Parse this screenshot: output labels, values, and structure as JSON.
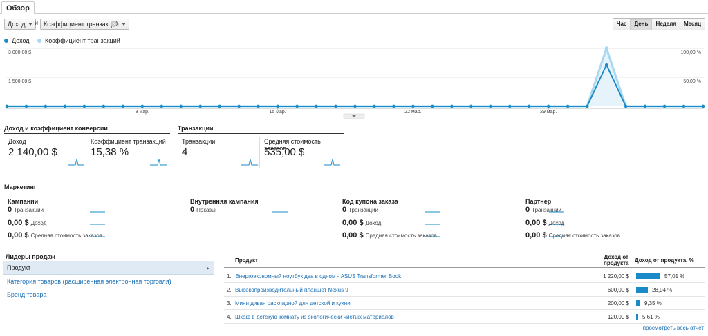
{
  "tabs": [
    {
      "label": "Обзор"
    }
  ],
  "controls": {
    "metric1": "Доход",
    "and_label": "и",
    "metric2": "Коэффициент транзакций",
    "clear": "×",
    "periods": [
      "Час",
      "День",
      "Неделя",
      "Месяц"
    ],
    "active_period": "День"
  },
  "legend": {
    "series1": "Доход",
    "series2": "Коэффициент транзакций",
    "color1": "#1a8bc8",
    "color2": "#a8d8f0"
  },
  "chart_data": {
    "type": "line",
    "x_tick_labels": [
      "8 мар.",
      "15 мар.",
      "22 мар.",
      "29 мар."
    ],
    "x_tick_index": [
      7,
      14,
      21,
      28
    ],
    "y_left_ticks": [
      "3 000,00 $",
      "1 500,00 $"
    ],
    "y_right_ticks": [
      "100,00 %",
      "50,00 %"
    ],
    "y_left_max": 3000,
    "y_right_max": 100,
    "series": [
      {
        "name": "Доход",
        "axis": "left",
        "values": [
          0,
          0,
          0,
          0,
          0,
          0,
          0,
          0,
          0,
          0,
          0,
          0,
          0,
          0,
          0,
          0,
          0,
          0,
          0,
          0,
          0,
          0,
          0,
          0,
          0,
          0,
          0,
          0,
          0,
          0,
          0,
          2140,
          0,
          0,
          0,
          0,
          0
        ]
      },
      {
        "name": "Коэффициент транзакций",
        "axis": "right",
        "values": [
          0,
          0,
          0,
          0,
          0,
          0,
          0,
          0,
          0,
          0,
          0,
          0,
          0,
          0,
          0,
          0,
          0,
          0,
          0,
          0,
          0,
          0,
          0,
          0,
          0,
          0,
          0,
          0,
          0,
          0,
          0,
          100,
          0,
          0,
          0,
          0,
          0
        ]
      }
    ]
  },
  "summary": {
    "section1_title": "Доход и коэффициент конверсии",
    "section2_title": "Транзакции",
    "cards": [
      {
        "label": "Доход",
        "value": "2 140,00 $"
      },
      {
        "label": "Коэффициент транзакций",
        "value": "15,38 %"
      },
      {
        "label": "Транзакции",
        "value": "4"
      },
      {
        "label": "Средняя стоимость заказов",
        "value": "535,00 $"
      }
    ]
  },
  "marketing": {
    "title": "Маркетинг",
    "columns": [
      {
        "heading": "Кампании",
        "rows": [
          {
            "value": "0",
            "label": "Транзакции"
          },
          {
            "value": "0,00 $",
            "label": "Доход"
          },
          {
            "value": "0,00 $",
            "label": "Средняя стоимость заказов"
          }
        ]
      },
      {
        "heading": "Внутренняя кампания",
        "rows": [
          {
            "value": "0",
            "label": "Показы"
          }
        ]
      },
      {
        "heading": "Код купона заказа",
        "rows": [
          {
            "value": "0",
            "label": "Транзакции"
          },
          {
            "value": "0,00 $",
            "label": "Доход"
          },
          {
            "value": "0,00 $",
            "label": "Средняя стоимость заказов"
          }
        ]
      },
      {
        "heading": "Партнер",
        "rows": [
          {
            "value": "0",
            "label": "Транзакции"
          },
          {
            "value": "0,00 $",
            "label": "Доход"
          },
          {
            "value": "0,00 $",
            "label": "Средняя стоимость заказов"
          }
        ]
      }
    ]
  },
  "leaders": {
    "title": "Лидеры продаж",
    "items": [
      {
        "label": "Продукт"
      },
      {
        "label": "Категория товаров (расширенная электронная торговля)"
      },
      {
        "label": "Бренд товара"
      }
    ],
    "chevron": "▸"
  },
  "products": {
    "col_product": "Продукт",
    "col_revenue_l1": "Доход от",
    "col_revenue_l2": "продукта",
    "col_share": "Доход от продукта, %",
    "rows": [
      {
        "num": "1.",
        "name": "Энергоэкономный ноутбук два в одном - ASUS Transformer Book",
        "revenue": "1 220,00 $",
        "share_pct": 57.01,
        "share": "57,01 %"
      },
      {
        "num": "2.",
        "name": "Высокопроизводительный планшет Nexus 9",
        "revenue": "600,00 $",
        "share_pct": 28.04,
        "share": "28,04 %"
      },
      {
        "num": "3.",
        "name": "Мини диван раскладной для детской и кухни",
        "revenue": "200,00 $",
        "share_pct": 9.35,
        "share": "9,35 %"
      },
      {
        "num": "4.",
        "name": "Шкаф в детскую комнату из экологически чистых материалов",
        "revenue": "120,00 $",
        "share_pct": 5.61,
        "share": "5,61 %"
      }
    ],
    "view_all": "просмотреть весь отчет"
  }
}
